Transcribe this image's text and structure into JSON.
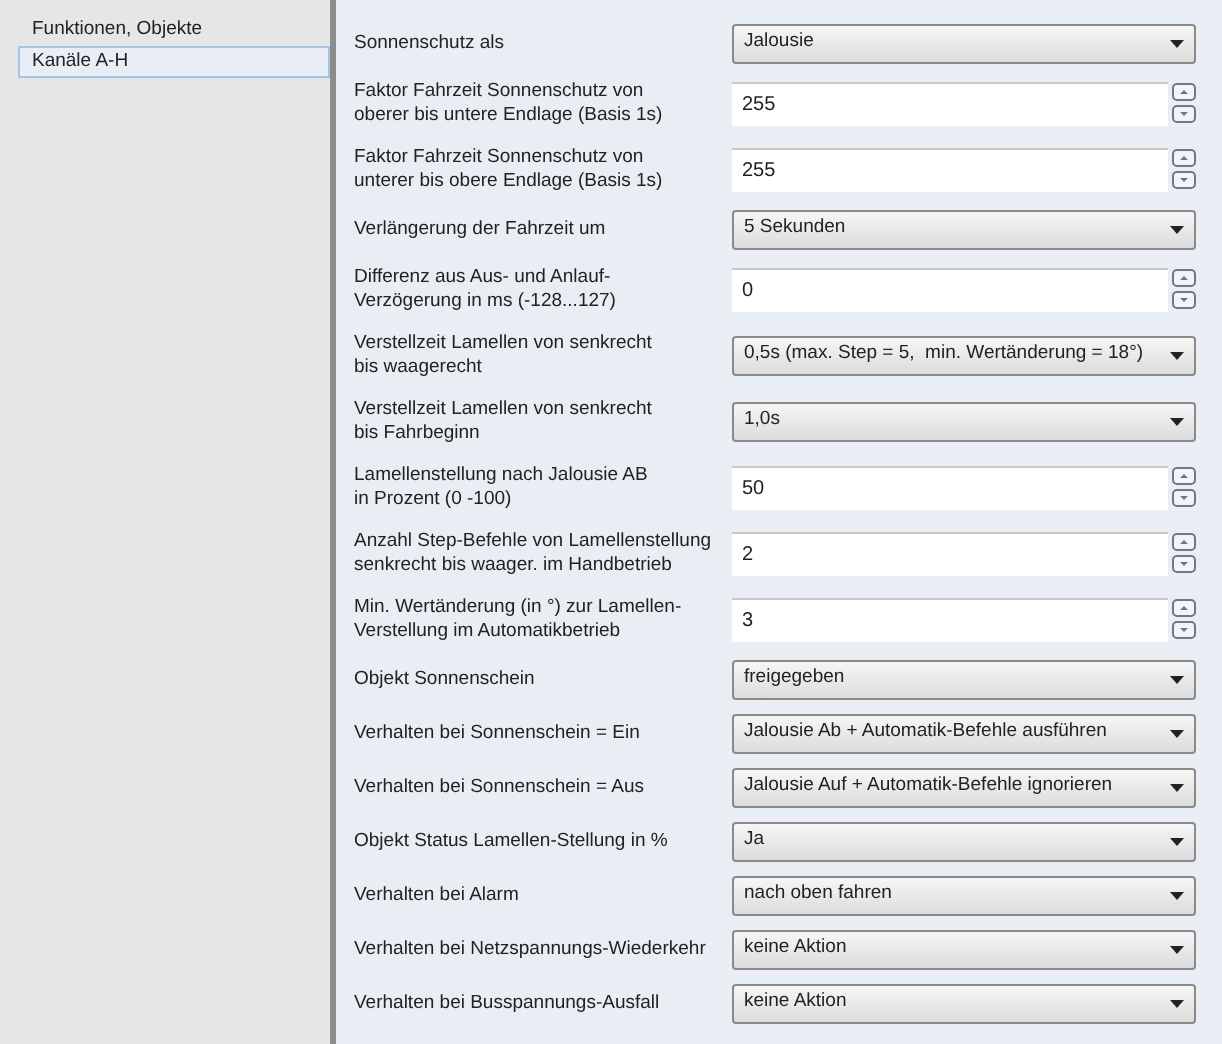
{
  "sidebar": {
    "items": [
      {
        "label": "Funktionen, Objekte",
        "selected": false
      },
      {
        "label": "Kanäle A-H",
        "selected": true
      }
    ]
  },
  "parameters": [
    {
      "label": "Sonnenschutz als",
      "kind": "dropdown",
      "value": "Jalousie"
    },
    {
      "label": "Faktor Fahrzeit Sonnenschutz von\noberer bis untere Endlage (Basis 1s)",
      "kind": "spin",
      "value": "255"
    },
    {
      "label": "Faktor Fahrzeit Sonnenschutz von\nunterer bis obere Endlage (Basis 1s)",
      "kind": "spin",
      "value": "255"
    },
    {
      "label": "Verlängerung der Fahrzeit um",
      "kind": "dropdown",
      "value": "5 Sekunden"
    },
    {
      "label": "Differenz aus Aus- und Anlauf-\nVerzögerung in ms (-128...127)",
      "kind": "spin",
      "value": "0"
    },
    {
      "label": "Verstellzeit Lamellen von senkrecht\nbis waagerecht",
      "kind": "dropdown",
      "value": "0,5s (max. Step = 5,  min. Wertänderung = 18°)"
    },
    {
      "label": "Verstellzeit Lamellen von senkrecht\nbis Fahrbeginn",
      "kind": "dropdown",
      "value": "1,0s"
    },
    {
      "label": "Lamellenstellung nach Jalousie AB\nin Prozent (0 -100)",
      "kind": "spin",
      "value": "50"
    },
    {
      "label": "Anzahl Step-Befehle von Lamellenstellung\nsenkrecht bis waager. im Handbetrieb",
      "kind": "spin",
      "value": "2"
    },
    {
      "label": "Min. Wertänderung (in °) zur Lamellen-\nVerstellung im Automatikbetrieb",
      "kind": "spin",
      "value": "3"
    },
    {
      "label": "Objekt Sonnenschein",
      "kind": "dropdown",
      "value": "freigegeben"
    },
    {
      "label": "Verhalten bei Sonnenschein = Ein",
      "kind": "dropdown",
      "value": "Jalousie Ab + Automatik-Befehle ausführen"
    },
    {
      "label": "Verhalten bei Sonnenschein = Aus",
      "kind": "dropdown",
      "value": "Jalousie Auf + Automatik-Befehle ignorieren"
    },
    {
      "label": "Objekt Status Lamellen-Stellung in %",
      "kind": "dropdown",
      "value": "Ja"
    },
    {
      "label": "Verhalten bei Alarm",
      "kind": "dropdown",
      "value": "nach oben fahren"
    },
    {
      "label": "Verhalten bei Netzspannungs-Wiederkehr",
      "kind": "dropdown",
      "value": "keine Aktion"
    },
    {
      "label": "Verhalten bei Busspannungs-Ausfall",
      "kind": "dropdown",
      "value": "keine Aktion"
    }
  ]
}
